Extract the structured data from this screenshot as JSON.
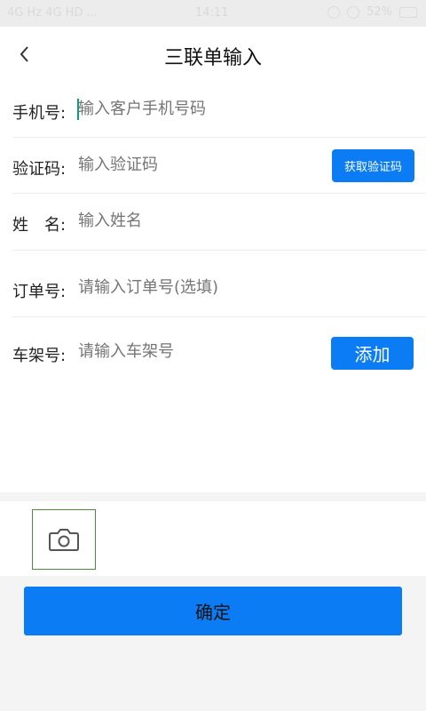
{
  "status_bar": {
    "left": "4G Hz 4G HD ...",
    "time": "14:11",
    "battery": "52%"
  },
  "header": {
    "title": "三联单输入"
  },
  "form": {
    "phone": {
      "label": "手机号:",
      "placeholder": "输入客户手机号码"
    },
    "code": {
      "label": "验证码:",
      "placeholder": "输入验证码",
      "button": "获取验证码"
    },
    "name": {
      "label": "姓　名:",
      "placeholder": "输入姓名"
    },
    "order": {
      "label": "订单号:",
      "placeholder": "请输入订单号(选填)"
    },
    "frame": {
      "label": "车架号:",
      "placeholder": "请输入车架号",
      "button": "添加"
    }
  },
  "confirm_label": "确定",
  "colors": {
    "accent": "#0b7cf3",
    "caret": "#0aa07a",
    "photo_border": "#4a8a3a"
  }
}
